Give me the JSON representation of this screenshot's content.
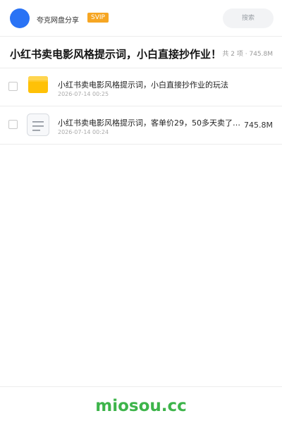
{
  "header": {
    "brand_name": "夸克网盘分享",
    "badge": "SVIP",
    "search_placeholder": "搜索"
  },
  "share": {
    "title": "小红书卖电影风格提示词，小白直接抄作业！",
    "summary": "共 2 项 · 745.8M"
  },
  "files": [
    {
      "name": "小红书卖电影风格提示词，小白直接抄作业的玩法",
      "date": "2026-07-14 00:25",
      "size": "",
      "icon": "folder-icon"
    },
    {
      "name": "小红书卖电影风格提示词，客单价29，50多天卖了7…",
      "date": "2026-07-14 00:24",
      "size": "745.8M",
      "icon": "document-icon"
    }
  ],
  "footer": {
    "brand": "miosou.cc"
  },
  "colors": {
    "avatar": "#2a73f5",
    "badge": "#f6a623",
    "folder": "#ffc107",
    "footer_brand": "#3db44a"
  }
}
